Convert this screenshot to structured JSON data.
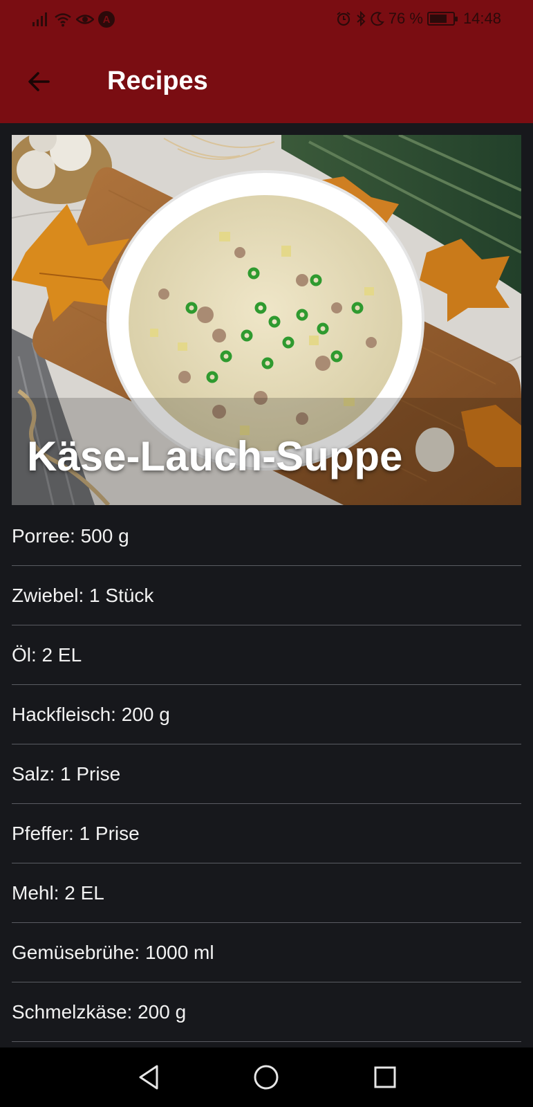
{
  "status_bar": {
    "battery_percent": "76 %",
    "battery_level": 0.76,
    "time": "14:48",
    "icons": [
      "signal-icon",
      "wifi-icon",
      "eye-icon",
      "navigation-a-icon",
      "alarm-icon",
      "bluetooth-icon",
      "moon-icon",
      "battery-icon"
    ]
  },
  "app_bar": {
    "title": "Recipes",
    "back_icon": "arrow-left-icon"
  },
  "recipe": {
    "title": "Käse-Lauch-Suppe",
    "ingredients": [
      "Porree: 500 g",
      "Zwiebel: 1 Stück",
      "Öl: 2 EL",
      "Hackfleisch: 200 g",
      "Salz: 1 Prise",
      "Pfeffer: 1 Prise",
      "Mehl: 2 EL",
      "Gemüsebrühe: 1000 ml",
      "Schmelzkäse: 200 g"
    ]
  },
  "nav_bar": {
    "buttons": [
      "back-triangle-icon",
      "home-circle-icon",
      "recents-square-icon"
    ]
  },
  "colors": {
    "app_bar": "#7a0d12",
    "background": "#17181c",
    "divider": "#5a5c62",
    "text": "#f2f2f2"
  }
}
